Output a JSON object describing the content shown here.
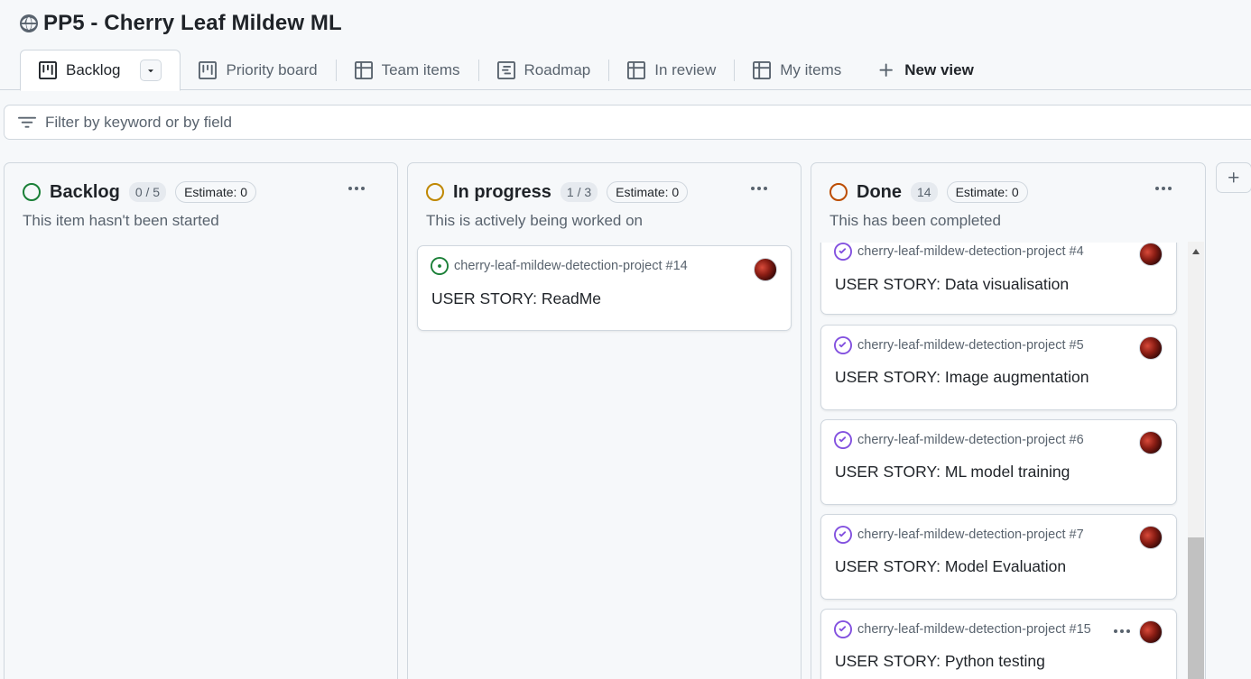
{
  "project": {
    "title": "PP5 - Cherry Leaf Mildew ML"
  },
  "tabs": [
    {
      "label": "Backlog",
      "icon": "board-icon",
      "active": true
    },
    {
      "label": "Priority board",
      "icon": "board-icon"
    },
    {
      "label": "Team items",
      "icon": "table-icon"
    },
    {
      "label": "Roadmap",
      "icon": "roadmap-icon"
    },
    {
      "label": "In review",
      "icon": "table-icon"
    },
    {
      "label": "My items",
      "icon": "table-icon"
    }
  ],
  "new_view_label": "New view",
  "filter": {
    "placeholder": "Filter by keyword or by field"
  },
  "columns": [
    {
      "name": "Backlog",
      "count": "0 / 5",
      "estimate": "Estimate: 0",
      "description": "This item hasn't been started",
      "color": "#1a7f37",
      "cards": []
    },
    {
      "name": "In progress",
      "count": "1 / 3",
      "estimate": "Estimate: 0",
      "description": "This is actively being worked on",
      "color": "#bf8700",
      "cards": [
        {
          "ref": "cherry-leaf-mildew-detection-project #14",
          "title": "USER STORY: ReadMe",
          "status": "open"
        }
      ]
    },
    {
      "name": "Done",
      "count": "14",
      "estimate": "Estimate: 0",
      "description": "This has been completed",
      "color": "#bc4c00",
      "cards": [
        {
          "ref": "cherry-leaf-mildew-detection-project #4",
          "title": "USER STORY: Data visualisation",
          "status": "closed"
        },
        {
          "ref": "cherry-leaf-mildew-detection-project #5",
          "title": "USER STORY: Image augmentation",
          "status": "closed"
        },
        {
          "ref": "cherry-leaf-mildew-detection-project #6",
          "title": "USER STORY: ML model training",
          "status": "closed"
        },
        {
          "ref": "cherry-leaf-mildew-detection-project #7",
          "title": "USER STORY: Model Evaluation",
          "status": "closed"
        },
        {
          "ref": "cherry-leaf-mildew-detection-project #15",
          "title": "USER STORY: Python testing",
          "status": "closed"
        }
      ]
    }
  ],
  "colors": {
    "open": "#1a7f37",
    "closed": "#8250df",
    "border": "#d0d7de",
    "muted": "#59636e"
  }
}
